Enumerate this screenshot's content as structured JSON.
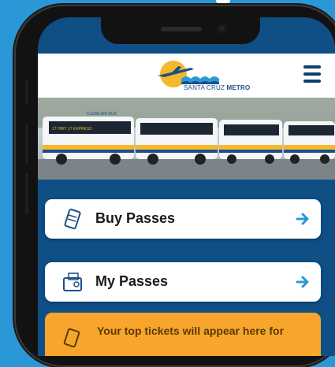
{
  "header": {
    "brand_prefix": "SANTA CRUZ",
    "brand_name": "METRO"
  },
  "hero": {
    "bus_side_text": "CLEAN AIR BUS",
    "bus_route_text": "17 HWY 17 EXPRESS"
  },
  "actions": {
    "buy_passes": "Buy Passes",
    "my_passes": "My Passes"
  },
  "notice": {
    "text": "Your top tickets will appear here for"
  },
  "colors": {
    "background": "#2a98d6",
    "screen_bg": "#0f4f86",
    "accent_arrow": "#2a98d6",
    "notice_bg": "#f7a52c",
    "brand_navy": "#0f3e6e"
  },
  "icons": {
    "menu": "hamburger-menu-icon",
    "buy": "ticket-icon",
    "my": "wallet-ticket-icon",
    "arrow": "arrow-right-icon",
    "notice": "ticket-outline-icon"
  }
}
